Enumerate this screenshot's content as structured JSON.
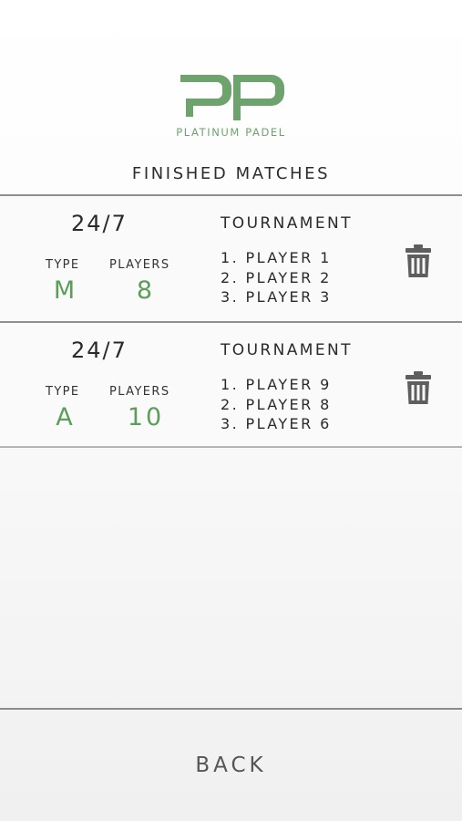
{
  "logo": {
    "monogram": "PP",
    "brand": "PLATINUM PADEL",
    "accent_color": "#6ea36e"
  },
  "section_title": "FINISHED MATCHES",
  "matches": [
    {
      "duration": "24/7",
      "type_label": "TYPE",
      "type_value": "M",
      "players_label": "PLAYERS",
      "players_value": "8",
      "mode": "TOURNAMENT",
      "ranking": [
        "1. PLAYER 1",
        "2. PLAYER 2",
        "3. PLAYER 3"
      ],
      "delete_icon": "trash-icon"
    },
    {
      "duration": "24/7",
      "type_label": "TYPE",
      "type_value": "A",
      "players_label": "PLAYERS",
      "players_value": "10",
      "mode": "TOURNAMENT",
      "ranking": [
        "1. PLAYER 9",
        "2. PLAYER 8",
        "3. PLAYER 6"
      ],
      "delete_icon": "trash-icon"
    }
  ],
  "footer": {
    "back_label": "BACK"
  },
  "colors": {
    "value_green": "#5a9e5a",
    "text_dark": "#2a2a2a",
    "divider": "#8f8f8f"
  }
}
